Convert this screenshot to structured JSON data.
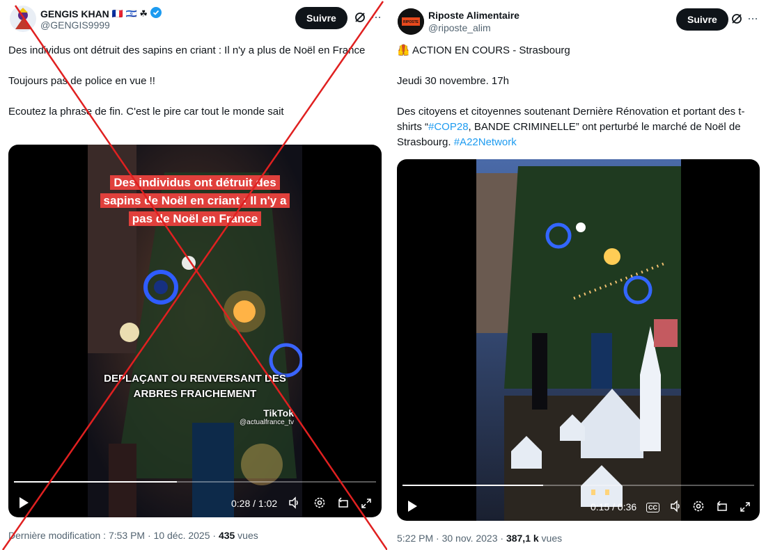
{
  "left": {
    "display_name": "GENGIS KHAN",
    "name_emojis": "🇫🇷 🇮🇱 ☘",
    "handle": "@GENGIS9999",
    "follow_label": "Suivre",
    "text_lines": [
      "Des individus ont détruit des sapins en criant : Il n'y a plus de Noël en France",
      "Toujours pas de police en vue !!",
      "Ecoutez la phrase de fin. C'est le pire car tout le monde sait"
    ],
    "video_caption_top": "Des individus ont détruit des sapins de Noël en criant : Il n'y a pas de Noël en France",
    "video_caption_bottom": "DEPLAÇANT OU RENVERSANT DES ARBRES FRAICHEMENT",
    "tiktok_label": "TikTok",
    "tiktok_handle": "@actualfrance_tv",
    "time": "0:28 / 1:02",
    "progress": 0.45,
    "footer_prefix": "Dernière modification : 7:53 PM · 10 déc. 2025 · ",
    "views_count": "435",
    "views_label": " vues",
    "cross_color": "#e02020"
  },
  "right": {
    "display_name": "Riposte Alimentaire",
    "handle": "@riposte_alim",
    "avatar_text": "RIPOSTE ALIMENTAIRE",
    "follow_label": "Suivre",
    "line1_emoji": "🦺",
    "line1": "ACTION EN COURS - Strasbourg",
    "line2": "Jeudi 30 novembre. 17h",
    "line3_a": "Des citoyens et citoyennes soutenant Dernière Rénovation et portant des t-shirts “",
    "line3_hashtag": "#COP28",
    "line3_b": ", BANDE CRIMINELLE” ont perturbé le marché de Noël de Strasbourg. ",
    "line3_hashtag2": "#A22Network",
    "time": "0:15 / 0:36",
    "cc_label": "CC",
    "progress": 0.4,
    "footer_prefix": "5:22 PM · 30 nov. 2023 · ",
    "views_count": "387,1 k",
    "views_label": " vues"
  },
  "colors": {
    "link": "#1d9bf0",
    "verified": "#1d9bf0",
    "caption_bg": "#e0403c"
  }
}
